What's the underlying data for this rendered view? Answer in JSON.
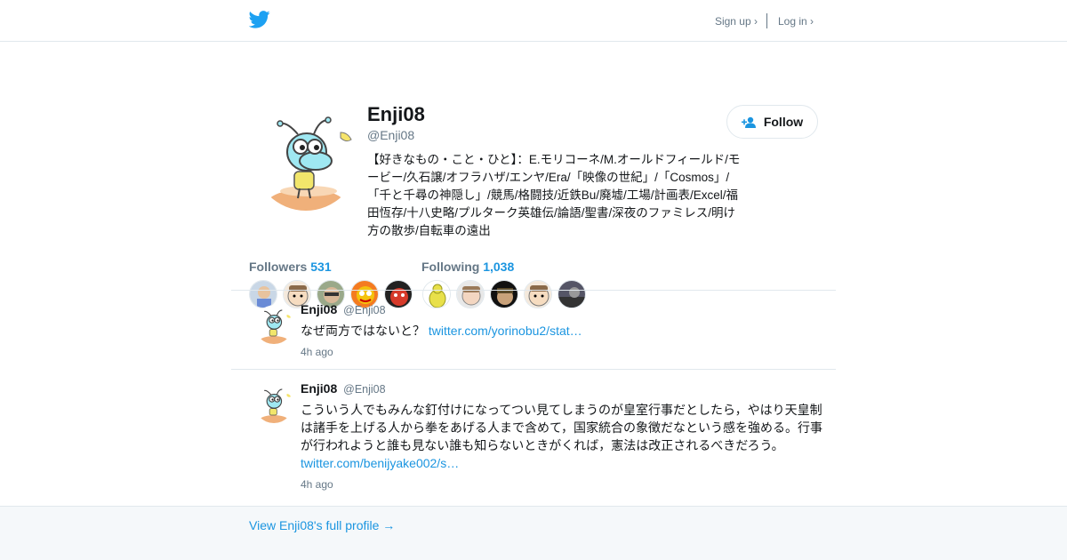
{
  "nav": {
    "signup": "Sign up ›",
    "login": "Log in ›"
  },
  "colors": {
    "accent": "#1b95e0",
    "muted": "#657786",
    "border": "#e1e8ed"
  },
  "profile": {
    "name": "Enji08",
    "handle": "@Enji08",
    "bio": "【好きなもの・こと・ひと】：E.モリコーネ/M.オールドフィールド/モービー/久石譲/オフラハザ/エンヤ/Era/「映像の世紀」/「Cosmos」/「千と千尋の神隠し」/競馬/格闘技/近鉄Bu/廃墟/工場/計画表/Excel/福田恆存/十八史略/プルターク英雄伝/論語/聖書/深夜のファミレス/明け方の散歩/自転車の遠出",
    "follow_label": "Follow"
  },
  "stats": {
    "followers_label": "Followers",
    "followers_count": "531",
    "following_label": "Following",
    "following_count": "1,038"
  },
  "tweets": [
    {
      "name": "Enji08",
      "handle": "@Enji08",
      "text": "なぜ両方ではないと？",
      "link": "twitter.com/yorinobu2/stat…",
      "time": "4h ago"
    },
    {
      "name": "Enji08",
      "handle": "@Enji08",
      "text": "こういう人でもみんな釘付けになってつい見てしまうのが皇室行事だとしたら，やはり天皇制は諸手を上げる人から拳をあげる人まで含めて，国家統合の象徴だなという感を強める。行事が行われようと誰も見ない誰も知らないときがくれば，憲法は改正されるべきだろう。",
      "link": "twitter.com/benijyake002/s…",
      "time": "4h ago"
    }
  ],
  "footer": {
    "full_profile": "View Enji08's full profile →"
  }
}
